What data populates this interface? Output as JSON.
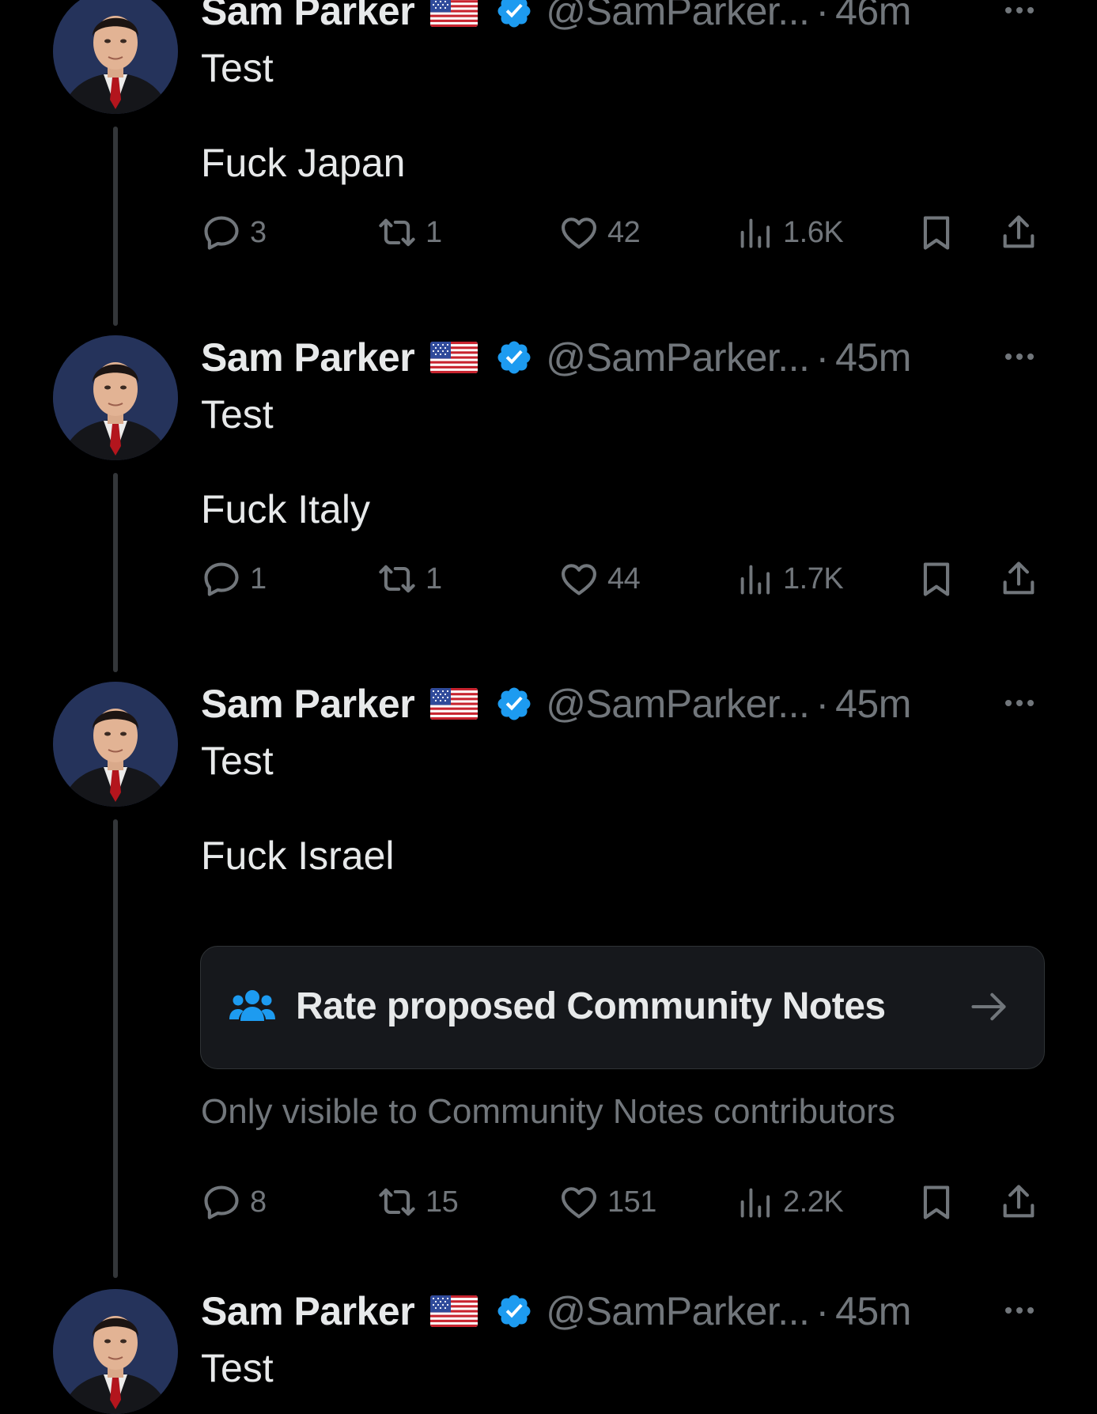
{
  "colors": {
    "background": "#000000",
    "text_primary": "#e7e9ea",
    "text_secondary": "#71767b",
    "verified_blue": "#1d9bf0",
    "thread_line": "#333639",
    "card_background": "#16181c"
  },
  "tweets": [
    {
      "display_name": "Sam Parker",
      "flag": "us-flag-emoji",
      "handle": "@SamParker...",
      "separator": "·",
      "time": "46m",
      "text": "Test\n\nFuck Japan",
      "actions": {
        "replies": "3",
        "reposts": "1",
        "likes": "42",
        "views": "1.6K"
      }
    },
    {
      "display_name": "Sam Parker",
      "flag": "us-flag-emoji",
      "handle": "@SamParker...",
      "separator": "·",
      "time": "45m",
      "text": "Test\n\nFuck Italy",
      "actions": {
        "replies": "1",
        "reposts": "1",
        "likes": "44",
        "views": "1.7K"
      }
    },
    {
      "display_name": "Sam Parker",
      "flag": "us-flag-emoji",
      "handle": "@SamParker...",
      "separator": "·",
      "time": "45m",
      "text": "Test\n\nFuck Israel",
      "community_notes": {
        "label": "Rate proposed Community Notes",
        "caption": "Only visible to Community Notes contributors"
      },
      "actions": {
        "replies": "8",
        "reposts": "15",
        "likes": "151",
        "views": "2.2K"
      }
    },
    {
      "display_name": "Sam Parker",
      "flag": "us-flag-emoji",
      "handle": "@SamParker...",
      "separator": "·",
      "time": "45m",
      "text": "Test"
    }
  ]
}
